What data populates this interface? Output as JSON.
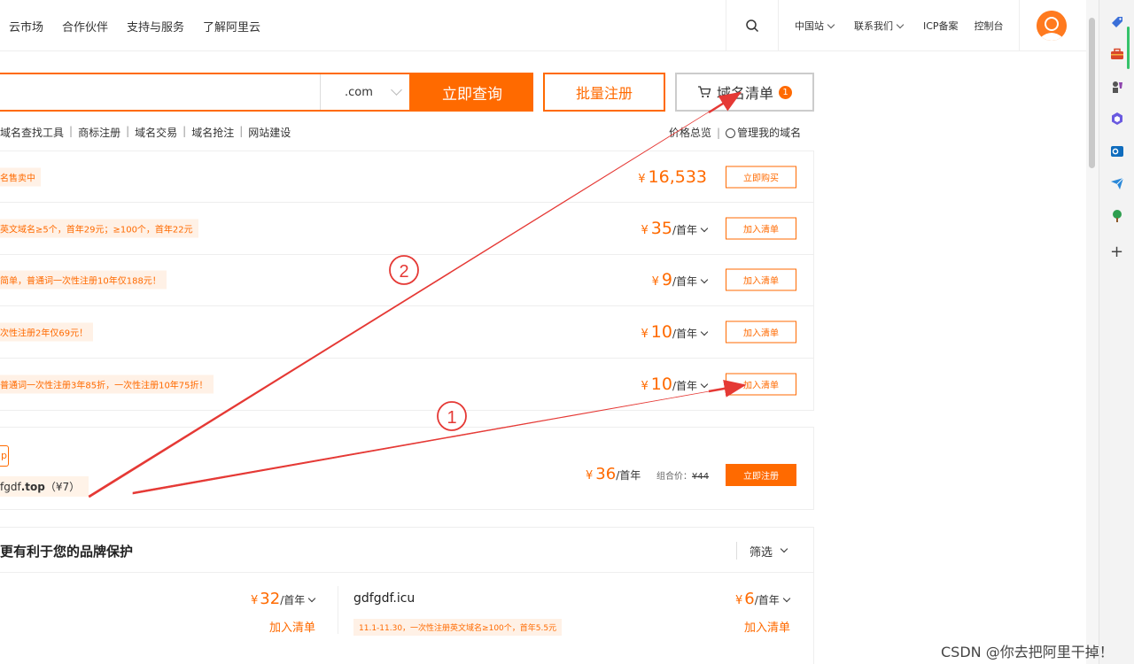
{
  "nav": {
    "left_items": [
      "云市场",
      "合作伙伴",
      "支持与服务",
      "了解阿里云"
    ],
    "right_items": [
      "中国站",
      "联系我们",
      "ICP备案",
      "控制台"
    ]
  },
  "search": {
    "suffix": ".com",
    "query_button": "立即查询",
    "bulk_button": "批量注册",
    "cart_label": "域名清单",
    "cart_count": "1"
  },
  "sublinks": {
    "left": [
      "域名查找工具",
      "商标注册",
      "域名交易",
      "域名抢注",
      "网站建设"
    ],
    "right": [
      "价格总览",
      "管理我的域名"
    ]
  },
  "results": [
    {
      "promo": "名售卖中",
      "yen": "¥",
      "price": "16,533",
      "unit": "",
      "dropdown": false,
      "button": "立即购买"
    },
    {
      "promo": "英文域名≥5个，首年29元；≥100个，首年22元",
      "yen": "¥",
      "price": "35",
      "unit": "/首年",
      "dropdown": true,
      "button": "加入清单"
    },
    {
      "promo": "简单，普通词一次性注册10年仅188元！",
      "yen": "¥",
      "price": "9",
      "unit": "/首年",
      "dropdown": true,
      "button": "加入清单"
    },
    {
      "promo": "次性注册2年仅69元！",
      "yen": "¥",
      "price": "10",
      "unit": "/首年",
      "dropdown": true,
      "button": "加入清单"
    },
    {
      "promo": "普通词一次性注册3年85折，一次性注册10年75折！",
      "yen": "¥",
      "price": "10",
      "unit": "/首年",
      "dropdown": true,
      "button": "加入清单"
    }
  ],
  "combo": {
    "tag": "p",
    "domain_prefix": "fgdf",
    "domain_suffix": ".top",
    "domain_extra": "（¥7）",
    "yen": "¥",
    "price": "36",
    "unit": "/首年",
    "combo_label": "组合价：",
    "combo_original": "¥44",
    "button": "立即注册"
  },
  "brand": {
    "title": "更有利于您的品牌保护",
    "filter": "筛选",
    "left_item": {
      "yen": "¥",
      "price": "32",
      "unit": "/首年",
      "add": "加入清单"
    },
    "right_item": {
      "domain": "gdfgdf.icu",
      "promo": "11.1-11.30，一次性注册英文域名≥100个，首年5.5元",
      "yen": "¥",
      "price": "6",
      "unit": "/首年",
      "add": "加入清单"
    }
  },
  "annotations": {
    "label_1": "1",
    "label_2": "2"
  },
  "watermark": "CSDN @你去把阿里干掉！",
  "colors": {
    "brand_orange": "#ff6a00",
    "annotation_red": "#e53935"
  }
}
